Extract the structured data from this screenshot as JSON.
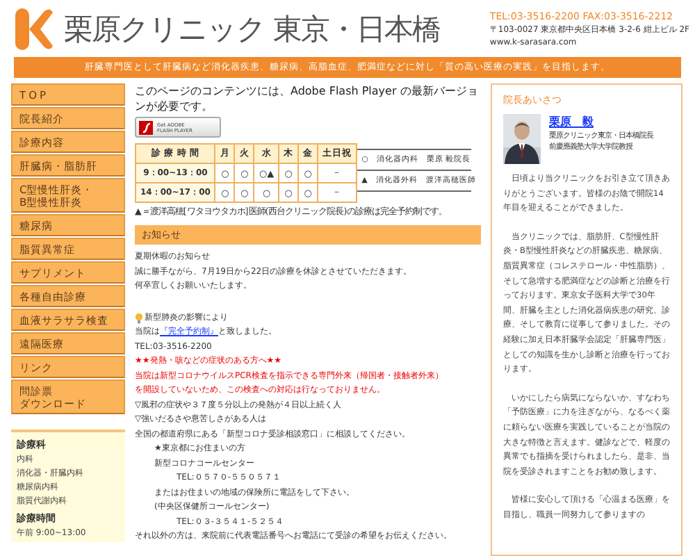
{
  "header": {
    "title": "栗原クリニック 東京・日本橋",
    "contact": "TEL:03-3516-2200 FAX:03-3516-2212",
    "address": "〒103-0027 東京都中央区日本橋 3-2-6 紺上ビル 2F",
    "url": "www.k-sarasara.com",
    "banner": "肝臓専門医として肝臓病など消化器疾患、糖尿病、高脂血症、肥満症などに対し「質の高い医療の実践」を目指します。"
  },
  "nav": [
    {
      "label": "TOP"
    },
    {
      "label": "院長紹介"
    },
    {
      "label": "診療内容"
    },
    {
      "label": "肝臓病・脂肪肝"
    },
    {
      "lines": [
        "C型慢性肝炎・",
        "B型慢性肝炎"
      ]
    },
    {
      "label": "糖尿病"
    },
    {
      "label": "脂質異常症"
    },
    {
      "label": "サプリメント"
    },
    {
      "label": "各種自由診療"
    },
    {
      "label": "血液サラサラ検査"
    },
    {
      "label": "遠隔医療"
    },
    {
      "label": "リンク"
    },
    {
      "lines": [
        "問診票",
        "ダウンロード"
      ]
    }
  ],
  "departments": {
    "title": "診療科",
    "items": [
      "内科",
      "消化器・肝臓内科",
      "糖尿病内科",
      "脂質代謝内科"
    ]
  },
  "hours": {
    "title": "診療時間",
    "items": [
      "午前 9:00~13:00"
    ]
  },
  "flash": {
    "message": "このページのコンテンツには、Adobe Flash Player の最新バージョンが必要です。",
    "badge_top": "Get ADOBE",
    "badge_bottom": "FLASH PLAYER"
  },
  "schedule": {
    "columns": [
      "診 療 時 間",
      "月",
      "火",
      "水",
      "木",
      "金",
      "土日祝"
    ],
    "rows": [
      [
        "9：00~13：00",
        "○",
        "○",
        "○▲",
        "○",
        "○",
        "－"
      ],
      [
        "14：00~17：00",
        "○",
        "○",
        "○",
        "○",
        "○",
        "－"
      ]
    ],
    "legend": [
      {
        "mark": "○",
        "text": "消化器内科　栗原 毅院長"
      },
      {
        "mark": "▲",
        "text": "消化器外科　渡洋高穂医師"
      }
    ],
    "note": "▲＝渡洋高穂[ワタヨウタカホ]医師(西台クリニック院長)の診療は完全予約制です。"
  },
  "notices": {
    "title": "お知らせ",
    "lines": [
      {
        "kind": "plain",
        "text": "夏期休暇のお知らせ"
      },
      {
        "kind": "plain",
        "text": "誠に勝手ながら、7月19日から22日の診療を休診とさせていただきます。"
      },
      {
        "kind": "plain",
        "text": "何卒宜しくお願いいたします。"
      },
      {
        "kind": "bulb",
        "text": "新型肺炎の影響により"
      },
      {
        "kind": "link",
        "before": "当院は",
        "link": "『完全予約制』",
        "after": "と致しました。"
      },
      {
        "kind": "plain",
        "text": "TEL:03-3516-2200"
      },
      {
        "kind": "alert",
        "text": "★★発熱・咳などの症状のある方へ★★"
      },
      {
        "kind": "alert",
        "text": "当院は新型コロナウイルスPCR検査を指示できる専門外来（帰国者・接触者外来）"
      },
      {
        "kind": "alert",
        "text": "を開設していないため、この検査への対応は行なっておりません。"
      },
      {
        "kind": "plain",
        "text": "▽風邪の症状や３７度５分以上の発熱が４日以上続く人"
      },
      {
        "kind": "plain",
        "text": "▽強いだるさや息苦しさがある人は"
      },
      {
        "kind": "plain",
        "text": "全国の都道府県にある「新型コロナ受診相談窓口」に相談してください。"
      },
      {
        "kind": "indent1",
        "text": "★東京都にお住まいの方"
      },
      {
        "kind": "indent1",
        "text": "新型コロナコールセンター"
      },
      {
        "kind": "indent2",
        "text": "TEL:０５７０-５５０５７１"
      },
      {
        "kind": "indent1",
        "text": "またはお住まいの地域の保険所に電話をして下さい。"
      },
      {
        "kind": "indent1",
        "text": "(中央区保健所コールセンター)"
      },
      {
        "kind": "indent2",
        "text": "TEL:０３-３５４１-５２５４"
      },
      {
        "kind": "plain",
        "text": "それ以外の方は、来院前に代表電話番号へお電話にて受診の希望をお伝えください。"
      }
    ]
  },
  "greeting": {
    "title": "院長あいさつ",
    "name": "栗原　毅",
    "roles": [
      "栗原クリニック東京・日本橋院長",
      "前慶應義塾大学大学院教授"
    ],
    "paragraphs": [
      "日頃より当クリニックをお引き立て頂きありがとうございます。皆様のお陰で開院14年目を迎えることができました。",
      "当クリニックでは、脂肪肝、C型慢性肝炎・B型慢性肝炎などの肝臓疾患、糖尿病、脂質異常症（コレステロール・中性脂肪）、そして急増する肥満症などの診断と治療を行っております。東京女子医科大学で30年間、肝臓を主とした消化器病疾患の研究、診療、そして教育に従事して参りました。その経験に加え日本肝臓学会認定「肝臓専門医」としての知識を生かし診断と治療を行っております。",
      "いかにしたら病気にならないか、すなわち「予防医療」に力を注ぎながら、なるべく薬に頼らない医療を実践していることが当院の大きな特徴と言えます。健診などで、軽度の異常でも指摘を受けられましたら、是非、当院を受診されますことをお勧め致します。",
      "皆様に安心して頂ける「心温まる医療」を目指し、職員一同努力して参りますの"
    ]
  }
}
